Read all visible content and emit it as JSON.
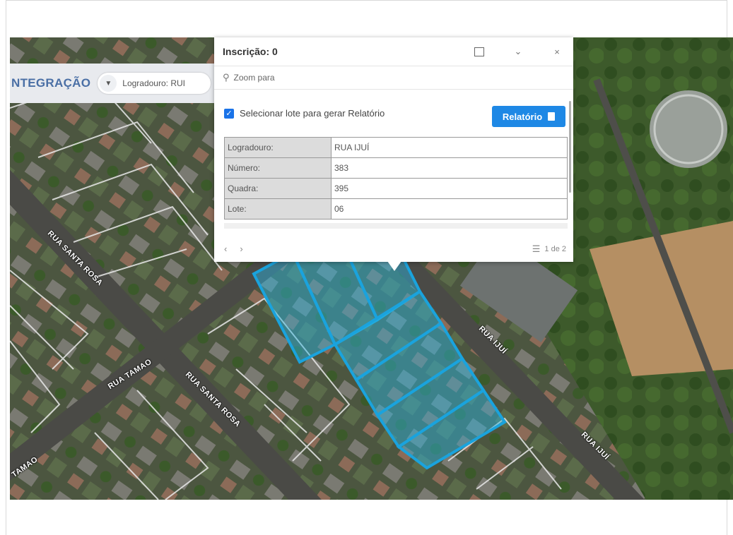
{
  "app": {
    "brand": "NTEGRAÇÃO"
  },
  "search": {
    "text": "Logradouro: RUI"
  },
  "popup": {
    "title": "Inscrição: 0",
    "zoom_label": "Zoom para",
    "select_label": "Selecionar lote para gerar Relatório",
    "report_button": "Relatório",
    "rows": [
      {
        "key": "Logradouro:",
        "value": "RUA IJUÍ"
      },
      {
        "key": "Número:",
        "value": "383"
      },
      {
        "key": "Quadra:",
        "value": "395"
      },
      {
        "key": "Lote:",
        "value": "06"
      }
    ],
    "page_count": "1 de 2"
  },
  "map": {
    "streets": [
      "RUA SANTA ROSA",
      "RUA TAMAO",
      "RUA SANTA ROSA",
      "RUA IJUÍ",
      "RUA IJUÍ",
      "TAMAO"
    ],
    "colors": {
      "selection": "#2ab7e6",
      "parcel_line": "#e8e8e8"
    }
  }
}
